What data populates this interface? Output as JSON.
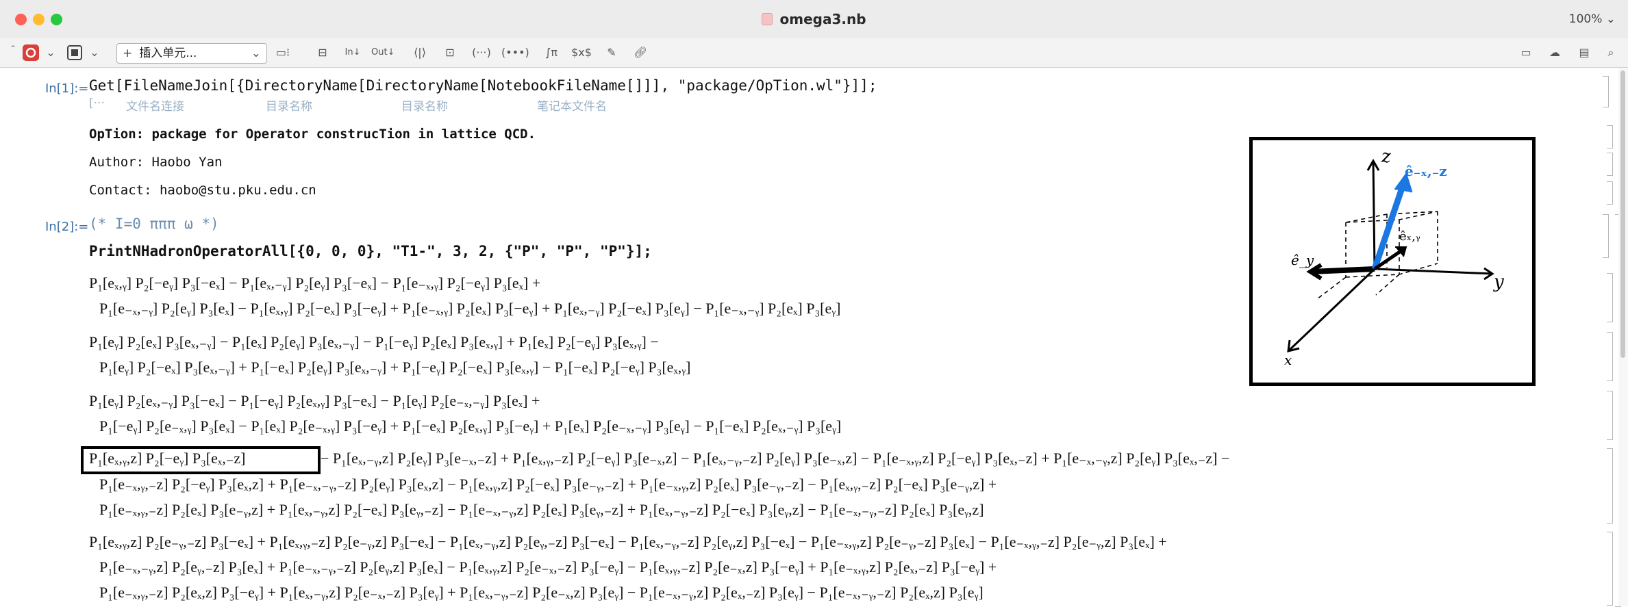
{
  "window": {
    "title": "omega3.nb",
    "zoom": "100% ⌄"
  },
  "toolbar": {
    "cell_style": "插入单元..."
  },
  "cells": [
    {
      "label": "In[1]:=",
      "code": "Get[FileNameJoin[{DirectoryName[DirectoryName[NotebookFileName[]]], \"package/OpTion.wl\"}]];",
      "hints": [
        "文件名连接",
        "目录名称",
        "目录名称",
        "笔记本文件名"
      ]
    },
    {
      "prints": [
        "OpTion: package for Operator construcTion in lattice QCD.",
        "Author: Haobo Yan",
        "Contact: haobo@stu.pku.edu.cn"
      ]
    },
    {
      "label": "In[2]:=",
      "comment": "(* I=0 πππ ω *)",
      "code": "PrintNHadronOperatorAll[{0, 0, 0}, \"T1-\", 3, 2, {\"P\", \"P\", \"P\"}];"
    }
  ],
  "output_lines": [
    "P₁[eₓ,ᵧ] P₂[−eᵧ] P₃[−eₓ] − P₁[eₓ,₋ᵧ] P₂[eᵧ] P₃[−eₓ] − P₁[e₋ₓ,ᵧ] P₂[−eᵧ] P₃[eₓ] +",
    "P₁[e₋ₓ,₋ᵧ] P₂[eᵧ] P₃[eₓ] − P₁[eₓ,ᵧ] P₂[−eₓ] P₃[−eᵧ] + P₁[e₋ₓ,ᵧ] P₂[eₓ] P₃[−eᵧ] + P₁[eₓ,₋ᵧ] P₂[−eₓ] P₃[eᵧ] − P₁[e₋ₓ,₋ᵧ] P₂[eₓ] P₃[eᵧ]",
    "P₁[eᵧ] P₂[eₓ] P₃[eₓ,₋ᵧ] − P₁[eₓ] P₂[eᵧ] P₃[eₓ,₋ᵧ] − P₁[−eᵧ] P₂[eₓ] P₃[eₓ,ᵧ] + P₁[eₓ] P₂[−eᵧ] P₃[eₓ,ᵧ] −",
    "P₁[eᵧ] P₂[−eₓ] P₃[eₓ,₋ᵧ] + P₁[−eₓ] P₂[eᵧ] P₃[eₓ,₋ᵧ] + P₁[−eᵧ] P₂[−eₓ] P₃[eₓ,ᵧ] − P₁[−eₓ] P₂[−eᵧ] P₃[eₓ,ᵧ]",
    "P₁[eᵧ] P₂[eₓ,₋ᵧ] P₃[−eₓ] − P₁[−eᵧ] P₂[eₓ,ᵧ] P₃[−eₓ] − P₁[eᵧ] P₂[e₋ₓ,₋ᵧ] P₃[eₓ] +",
    "P₁[−eᵧ] P₂[e₋ₓ,ᵧ] P₃[eₓ] − P₁[eₓ] P₂[e₋ₓ,ᵧ] P₃[−eᵧ] + P₁[−eₓ] P₂[eₓ,ᵧ] P₃[−eᵧ] + P₁[eₓ] P₂[e₋ₓ,₋ᵧ] P₃[eᵧ] − P₁[−eₓ] P₂[eₓ,₋ᵧ] P₃[eᵧ]",
    "− P₁[eₓ,₋ᵧ,z] P₂[eᵧ] P₃[e₋ₓ,₋z] + P₁[eₓ,ᵧ,₋z] P₂[−eᵧ] P₃[e₋ₓ,z] − P₁[eₓ,₋ᵧ,₋z] P₂[eᵧ] P₃[e₋ₓ,z] − P₁[e₋ₓ,ᵧ,z] P₂[−eᵧ] P₃[eₓ,₋z] + P₁[e₋ₓ,₋ᵧ,z] P₂[eᵧ] P₃[eₓ,₋z] −",
    "P₁[e₋ₓ,ᵧ,₋z] P₂[−eᵧ] P₃[eₓ,z] + P₁[e₋ₓ,₋ᵧ,₋z] P₂[eᵧ] P₃[eₓ,z] − P₁[eₓ,ᵧ,z] P₂[−eₓ] P₃[e₋ᵧ,₋z] + P₁[e₋ₓ,ᵧ,z] P₂[eₓ] P₃[e₋ᵧ,₋z] − P₁[eₓ,ᵧ,₋z] P₂[−eₓ] P₃[e₋ᵧ,z] +",
    "P₁[e₋ₓ,ᵧ,₋z] P₂[eₓ] P₃[e₋ᵧ,z] + P₁[eₓ,₋ᵧ,z] P₂[−eₓ] P₃[eᵧ,₋z] − P₁[e₋ₓ,₋ᵧ,z] P₂[eₓ] P₃[eᵧ,₋z] + P₁[eₓ,₋ᵧ,₋z] P₂[−eₓ] P₃[eᵧ,z] − P₁[e₋ₓ,₋ᵧ,₋z] P₂[eₓ] P₃[eᵧ,z]",
    "P₁[eₓ,ᵧ,z] P₂[e₋ᵧ,₋z] P₃[−eₓ] + P₁[eₓ,ᵧ,₋z] P₂[e₋ᵧ,z] P₃[−eₓ] − P₁[eₓ,₋ᵧ,z] P₂[eᵧ,₋z] P₃[−eₓ] − P₁[eₓ,₋ᵧ,₋z] P₂[eᵧ,z] P₃[−eₓ] − P₁[e₋ₓ,ᵧ,z] P₂[e₋ᵧ,₋z] P₃[eₓ] − P₁[e₋ₓ,ᵧ,₋z] P₂[e₋ᵧ,z] P₃[eₓ] +",
    "P₁[e₋ₓ,₋ᵧ,z] P₂[eᵧ,₋z] P₃[eₓ] + P₁[e₋ₓ,₋ᵧ,₋z] P₂[eᵧ,z] P₃[eₓ] − P₁[eₓ,ᵧ,z] P₂[e₋ₓ,₋z] P₃[−eᵧ] − P₁[eₓ,ᵧ,₋z] P₂[e₋ₓ,z] P₃[−eᵧ] + P₁[e₋ₓ,ᵧ,z] P₂[eₓ,₋z] P₃[−eᵧ] +",
    "P₁[e₋ₓ,ᵧ,₋z] P₂[eₓ,z] P₃[−eᵧ] + P₁[eₓ,₋ᵧ,z] P₂[e₋ₓ,₋z] P₃[eᵧ] + P₁[eₓ,₋ᵧ,₋z] P₂[e₋ₓ,z] P₃[eᵧ] − P₁[e₋ₓ,₋ᵧ,z] P₂[eₓ,₋z] P₃[eᵧ] − P₁[e₋ₓ,₋ᵧ,₋z] P₂[eₓ,z] P₃[eᵧ]"
  ],
  "highlight_term": "P₁[eₓ,ᵧ,z] P₂[−eᵧ] P₃[eₓ,₋z]",
  "figure": {
    "axis_z": "z",
    "axis_y": "y",
    "axis_x": "x",
    "vec_blue": "ê₋ₓ,₋z",
    "vec_black": "êₓ,ᵧ",
    "vec_left": "ê_y"
  }
}
